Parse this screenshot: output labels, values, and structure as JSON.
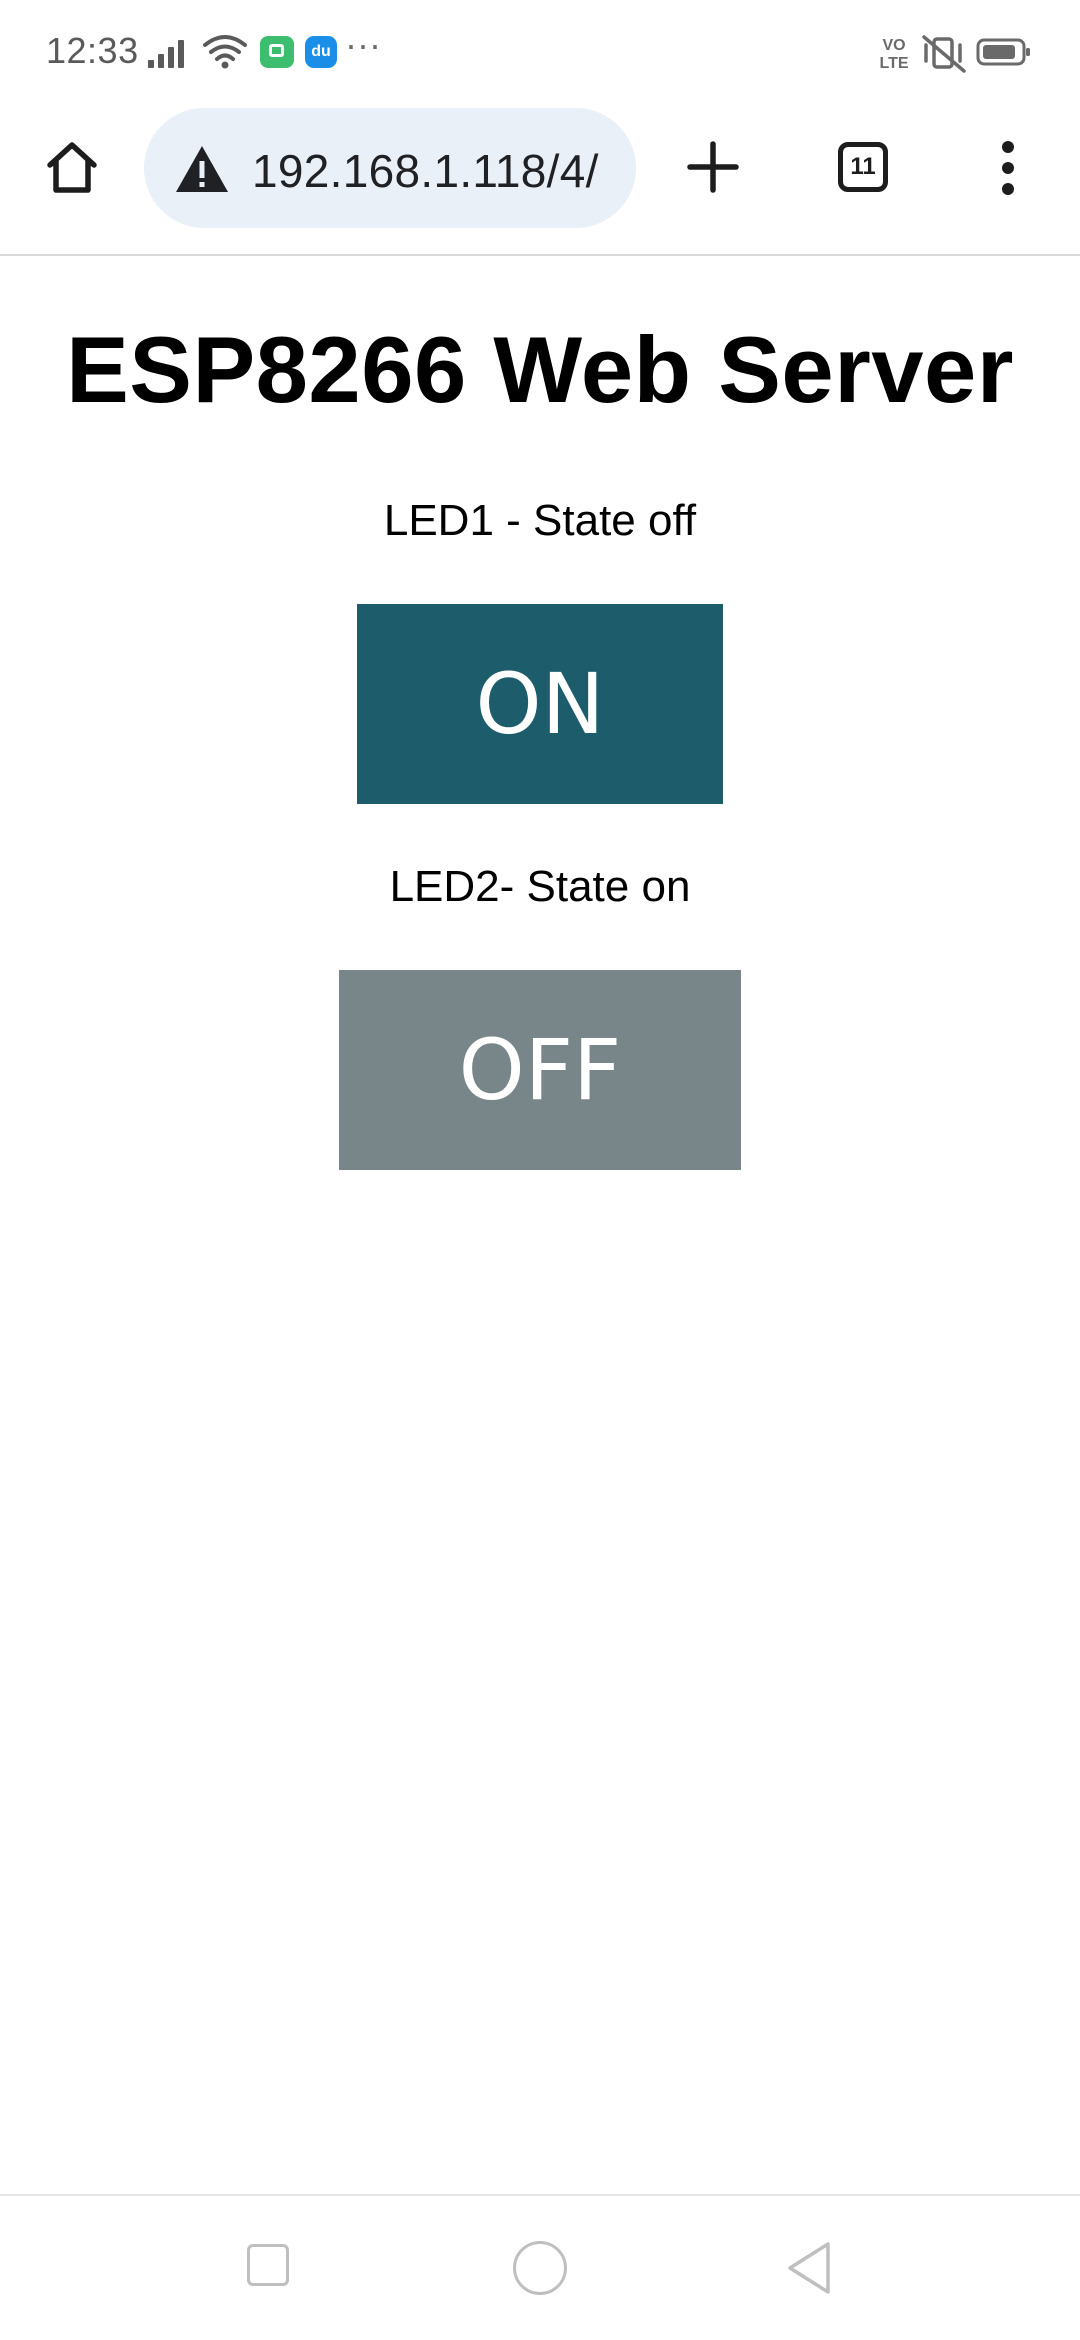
{
  "status_bar": {
    "time": "12:33",
    "app_icon_label": "du",
    "more": "···",
    "volte": "VO LTE",
    "icons": [
      "signal-icon",
      "wifi-icon",
      "message-icon",
      "app-icon",
      "more-icon",
      "volte-icon",
      "vibrate-mute-icon",
      "battery-icon"
    ]
  },
  "browser": {
    "url": "192.168.1.118/4/",
    "tab_count": "11",
    "icons": [
      "home-icon",
      "warning-icon",
      "new-tab-icon",
      "tab-switcher-icon",
      "menu-icon"
    ]
  },
  "page": {
    "title": "ESP8266 Web Server",
    "led1_state": "LED1 - State off",
    "led1_button": "ON",
    "led2_state": "LED2- State on",
    "led2_button": "OFF"
  },
  "colors": {
    "on_button": "#1c5c6b",
    "off_button": "#788689",
    "omnibox": "#eaf0f8"
  },
  "nav_bar": {
    "icons": [
      "recents-icon",
      "home-circle-icon",
      "back-icon"
    ]
  }
}
